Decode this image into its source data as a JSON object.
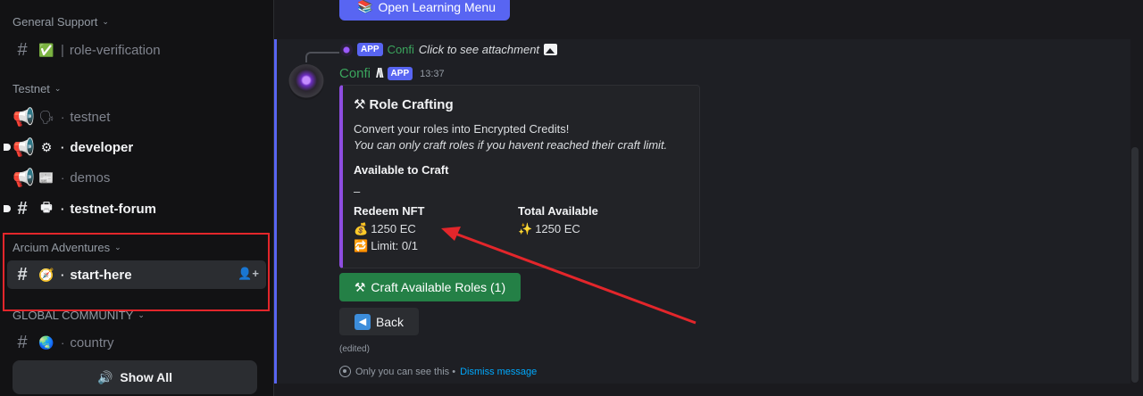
{
  "sidebar": {
    "categories": [
      {
        "label": "General Support"
      },
      {
        "label": "Testnet"
      },
      {
        "label": "Arcium Adventures"
      },
      {
        "label": "GLOBAL COMMUNITY"
      }
    ],
    "channels": {
      "role_verification": {
        "emoji": "✅",
        "sep": "|",
        "name": "role-verification"
      },
      "testnet": {
        "emoji": "🗣",
        "dot": "·",
        "name": "testnet"
      },
      "developer": {
        "emoji": "⚙",
        "dot": "·",
        "name": "developer"
      },
      "demos": {
        "emoji": "📰",
        "dot": "·",
        "name": "demos"
      },
      "testnet_forum": {
        "emoji": "🖶",
        "dot": "·",
        "name": "testnet-forum"
      },
      "start_here": {
        "emoji": "🧭",
        "dot": "·",
        "name": "start-here"
      },
      "country": {
        "emoji": "🌏",
        "dot": "·",
        "name": "country"
      }
    },
    "show_all": {
      "icon": "🔊",
      "label": "Show All"
    }
  },
  "main": {
    "open_learning": {
      "icon": "📚",
      "label": "Open Learning Menu"
    },
    "reply": {
      "app_tag": "APP",
      "name": "Confi",
      "text": "Click to see attachment"
    },
    "author": {
      "name": "Confi",
      "badge": "/\\\\",
      "app_tag": "APP",
      "time": "13:37"
    },
    "embed": {
      "title_icon": "⚒",
      "title": "Role Crafting",
      "desc1": "Convert your roles into Encrypted Credits!",
      "desc2": "You can only craft roles if you havent reached their craft limit.",
      "field_available": "Available to Craft",
      "field_available_value": "–",
      "field_redeem": "Redeem NFT",
      "redeem_amount_icon": "💰",
      "redeem_amount": "1250 EC",
      "redeem_limit_icon": "🔁",
      "redeem_limit": "Limit: 0/1",
      "field_total": "Total Available",
      "total_icon": "✨",
      "total_amount": "1250 EC"
    },
    "craft_button": {
      "icon": "⚒",
      "label": "Craft Available Roles (1)"
    },
    "back_button": {
      "icon": "◀",
      "label": "Back"
    },
    "edited": "(edited)",
    "only_you": "Only you can see this •",
    "dismiss": "Dismiss message"
  },
  "colors": {
    "accent": "#5865f2",
    "embed_border": "#8e4de0",
    "craft_green": "#248046",
    "annotation_red": "#e3262b",
    "link": "#00a8fc"
  }
}
